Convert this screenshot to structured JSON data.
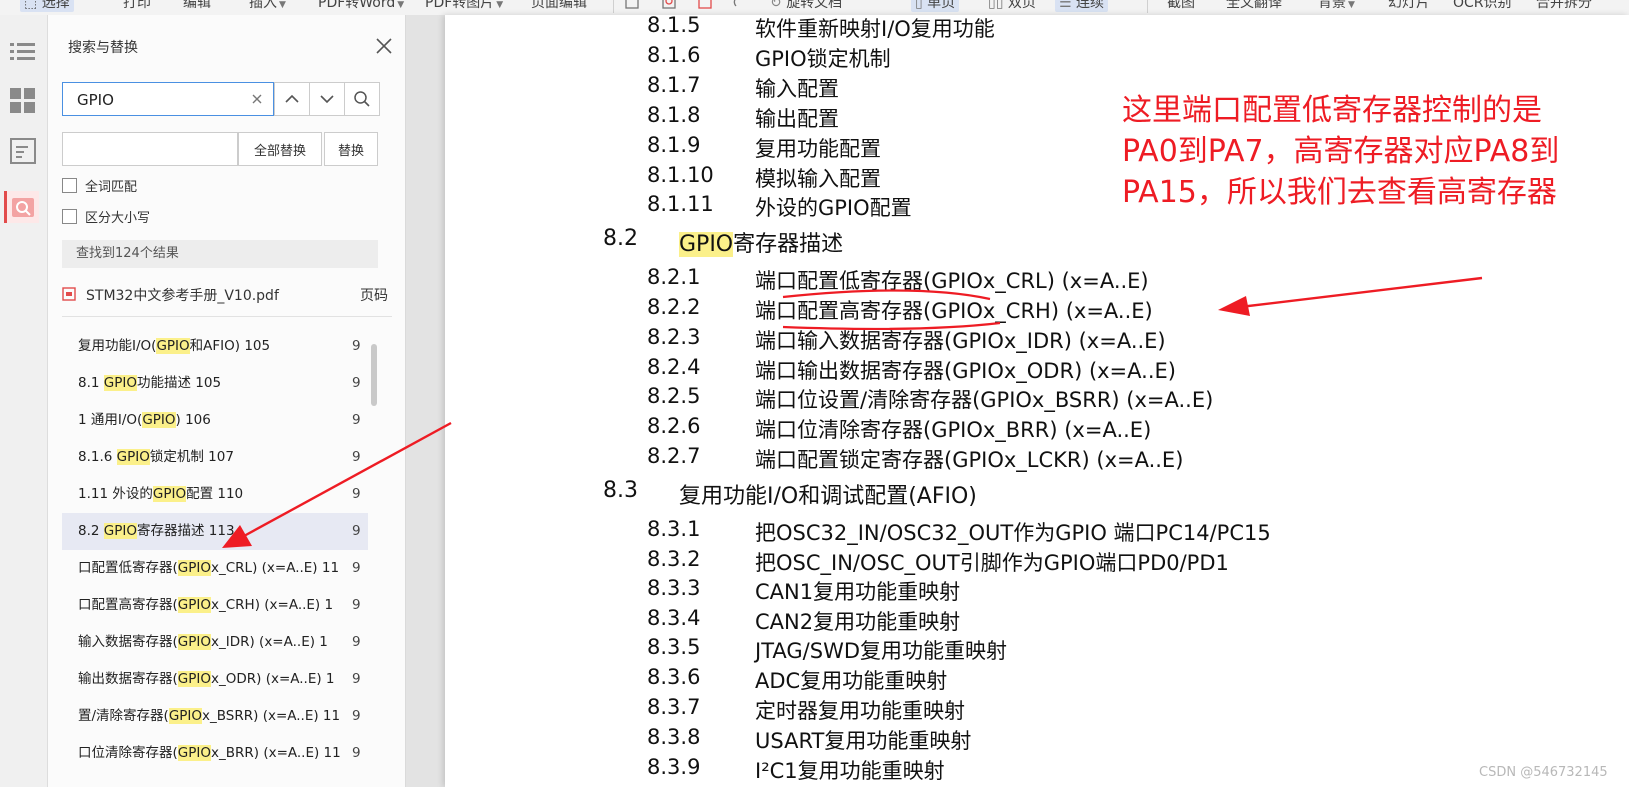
{
  "toolbar": {
    "items": [
      "选择",
      "打印",
      "编辑",
      "插入",
      "PDF转Word",
      "PDF转图片",
      "页面编辑",
      "旋转文档",
      "单页",
      "双页",
      "连续",
      "截图",
      "全文翻译",
      "背景",
      "幻灯片",
      "OCR识别",
      "合并拆分"
    ]
  },
  "search_panel": {
    "title": "搜索与替换",
    "query": "GPIO",
    "replace_all_label": "全部替换",
    "replace_label": "替换",
    "whole_word_label": "全词匹配",
    "case_sensitive_label": "区分大小写",
    "result_count": "查找到124个结果",
    "file_name": "STM32中文参考手册_V10.pdf",
    "page_header": "页码",
    "results": [
      {
        "before": "复用功能I/O(",
        "hl": "GPIO",
        "after": "和AFIO) 105",
        "page": "9"
      },
      {
        "before": "8.1 ",
        "hl": "GPIO",
        "after": "功能描述 105",
        "page": "9"
      },
      {
        "before": "1 通用I/O(",
        "hl": "GPIO",
        "after": ") 106",
        "page": "9"
      },
      {
        "before": "8.1.6 ",
        "hl": "GPIO",
        "after": "锁定机制 107",
        "page": "9"
      },
      {
        "before": "1.11 外设的",
        "hl": "GPIO",
        "after": "配置 110",
        "page": "9"
      },
      {
        "before": "8.2 ",
        "hl": "GPIO",
        "after": "寄存器描述 113",
        "page": "9"
      },
      {
        "before": "口配置低寄存器(",
        "hl": "GPIO",
        "after": "x_CRL) (x=A..E) 11",
        "page": "9"
      },
      {
        "before": "口配置高寄存器(",
        "hl": "GPIO",
        "after": "x_CRH) (x=A..E) 1",
        "page": "9"
      },
      {
        "before": "输入数据寄存器(",
        "hl": "GPIO",
        "after": "x_IDR) (x=A..E) 1",
        "page": "9"
      },
      {
        "before": "输出数据寄存器(",
        "hl": "GPIO",
        "after": "x_ODR) (x=A..E) 1",
        "page": "9"
      },
      {
        "before": "置/清除寄存器(",
        "hl": "GPIO",
        "after": "x_BSRR) (x=A..E) 11",
        "page": "9"
      },
      {
        "before": "口位清除寄存器(",
        "hl": "GPIO",
        "after": "x_BRR) (x=A..E) 11",
        "page": "9"
      }
    ]
  },
  "document": {
    "toc": [
      {
        "num": "8.1.5",
        "title": "软件重新映射I/O复用功能",
        "level": 2
      },
      {
        "num": "8.1.6",
        "title": "GPIO锁定机制",
        "level": 2
      },
      {
        "num": "8.1.7",
        "title": "输入配置",
        "level": 2
      },
      {
        "num": "8.1.8",
        "title": "输出配置",
        "level": 2
      },
      {
        "num": "8.1.9",
        "title": "复用功能配置",
        "level": 2
      },
      {
        "num": "8.1.10",
        "title": "模拟输入配置",
        "level": 2
      },
      {
        "num": "8.1.11",
        "title": "外设的GPIO配置",
        "level": 2
      },
      {
        "num": "8.2",
        "title": "GPIO寄存器描述",
        "level": 1
      },
      {
        "num": "8.2.1",
        "title": "端口配置低寄存器(GPIOx_CRL) (x=A..E)",
        "level": 2
      },
      {
        "num": "8.2.2",
        "title": "端口配置高寄存器(GPIOx_CRH) (x=A..E)",
        "level": 2
      },
      {
        "num": "8.2.3",
        "title": "端口输入数据寄存器(GPIOx_IDR) (x=A..E)",
        "level": 2
      },
      {
        "num": "8.2.4",
        "title": "端口输出数据寄存器(GPIOx_ODR) (x=A..E)",
        "level": 2
      },
      {
        "num": "8.2.5",
        "title": "端口位设置/清除寄存器(GPIOx_BSRR) (x=A..E)",
        "level": 2
      },
      {
        "num": "8.2.6",
        "title": "端口位清除寄存器(GPIOx_BRR) (x=A..E)",
        "level": 2
      },
      {
        "num": "8.2.7",
        "title": "端口配置锁定寄存器(GPIOx_LCKR) (x=A..E)",
        "level": 2
      },
      {
        "num": "8.3",
        "title": "复用功能I/O和调试配置(AFIO)",
        "level": 1
      },
      {
        "num": "8.3.1",
        "title": "把OSC32_IN/OSC32_OUT作为GPIO 端口PC14/PC15",
        "level": 2
      },
      {
        "num": "8.3.2",
        "title": "把OSC_IN/OSC_OUT引脚作为GPIO端口PD0/PD1",
        "level": 2
      },
      {
        "num": "8.3.3",
        "title": "CAN1复用功能重映射",
        "level": 2
      },
      {
        "num": "8.3.4",
        "title": "CAN2复用功能重映射",
        "level": 2
      },
      {
        "num": "8.3.5",
        "title": "JTAG/SWD复用功能重映射",
        "level": 2
      },
      {
        "num": "8.3.6",
        "title": "ADC复用功能重映射",
        "level": 2
      },
      {
        "num": "8.3.7",
        "title": "定时器复用功能重映射",
        "level": 2
      },
      {
        "num": "8.3.8",
        "title": "USART复用功能重映射",
        "level": 2
      },
      {
        "num": "8.3.9",
        "title": "I²C1复用功能重映射",
        "level": 2
      }
    ],
    "annotation_lines": [
      "这里端口配置低寄存器控制的是",
      "PA0到PA7，高寄存器对应PA8到",
      "PA15，所以我们去查看高寄存器"
    ]
  },
  "watermark": "CSDN @546732145",
  "colors": {
    "annotation": "#ee1c24",
    "highlight": "#fbf08a",
    "accent": "#4a90e2"
  }
}
